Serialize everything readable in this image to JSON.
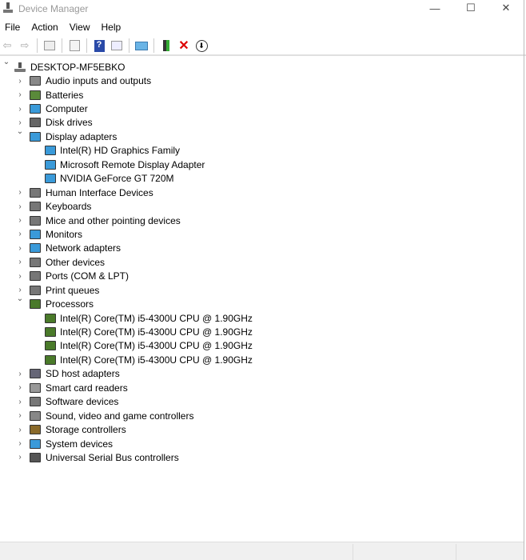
{
  "window": {
    "title": "Device Manager",
    "minimize": "—",
    "maximize": "☐",
    "close": "✕"
  },
  "menu": [
    "File",
    "Action",
    "View",
    "Help"
  ],
  "toolbar": [
    "back",
    "forward",
    "properties",
    "update-driver",
    "help",
    "show-hidden",
    "scan-hardware",
    "add-driver",
    "uninstall",
    "disable"
  ],
  "tree": {
    "root": "DESKTOP-MF5EBKO",
    "categories": [
      {
        "label": "Audio inputs and outputs",
        "icon": "speaker",
        "color": "#888"
      },
      {
        "label": "Batteries",
        "icon": "battery",
        "color": "#5a8a3a"
      },
      {
        "label": "Computer",
        "icon": "monitor",
        "color": "#3a9ad9"
      },
      {
        "label": "Disk drives",
        "icon": "disk",
        "color": "#666"
      },
      {
        "label": "Display adapters",
        "icon": "display",
        "color": "#3a9ad9",
        "expanded": true,
        "children": [
          "Intel(R) HD Graphics Family",
          "Microsoft Remote Display Adapter",
          "NVIDIA GeForce GT 720M"
        ]
      },
      {
        "label": "Human Interface Devices",
        "icon": "hid",
        "color": "#777"
      },
      {
        "label": "Keyboards",
        "icon": "keyboard",
        "color": "#777"
      },
      {
        "label": "Mice and other pointing devices",
        "icon": "mouse",
        "color": "#777"
      },
      {
        "label": "Monitors",
        "icon": "monitor",
        "color": "#3a9ad9"
      },
      {
        "label": "Network adapters",
        "icon": "network",
        "color": "#3a9ad9"
      },
      {
        "label": "Other devices",
        "icon": "unknown",
        "color": "#777"
      },
      {
        "label": "Ports (COM & LPT)",
        "icon": "port",
        "color": "#777"
      },
      {
        "label": "Print queues",
        "icon": "printer",
        "color": "#777"
      },
      {
        "label": "Processors",
        "icon": "cpu",
        "color": "#4a7a2a",
        "expanded": true,
        "children": [
          "Intel(R) Core(TM) i5-4300U CPU @ 1.90GHz",
          "Intel(R) Core(TM) i5-4300U CPU @ 1.90GHz",
          "Intel(R) Core(TM) i5-4300U CPU @ 1.90GHz",
          "Intel(R) Core(TM) i5-4300U CPU @ 1.90GHz"
        ]
      },
      {
        "label": "SD host adapters",
        "icon": "sd",
        "color": "#667"
      },
      {
        "label": "Smart card readers",
        "icon": "smartcard",
        "color": "#999"
      },
      {
        "label": "Software devices",
        "icon": "software",
        "color": "#777"
      },
      {
        "label": "Sound, video and game controllers",
        "icon": "sound",
        "color": "#888"
      },
      {
        "label": "Storage controllers",
        "icon": "storage",
        "color": "#8a6a2a"
      },
      {
        "label": "System devices",
        "icon": "system",
        "color": "#3a9ad9"
      },
      {
        "label": "Universal Serial Bus controllers",
        "icon": "usb",
        "color": "#555"
      }
    ]
  }
}
